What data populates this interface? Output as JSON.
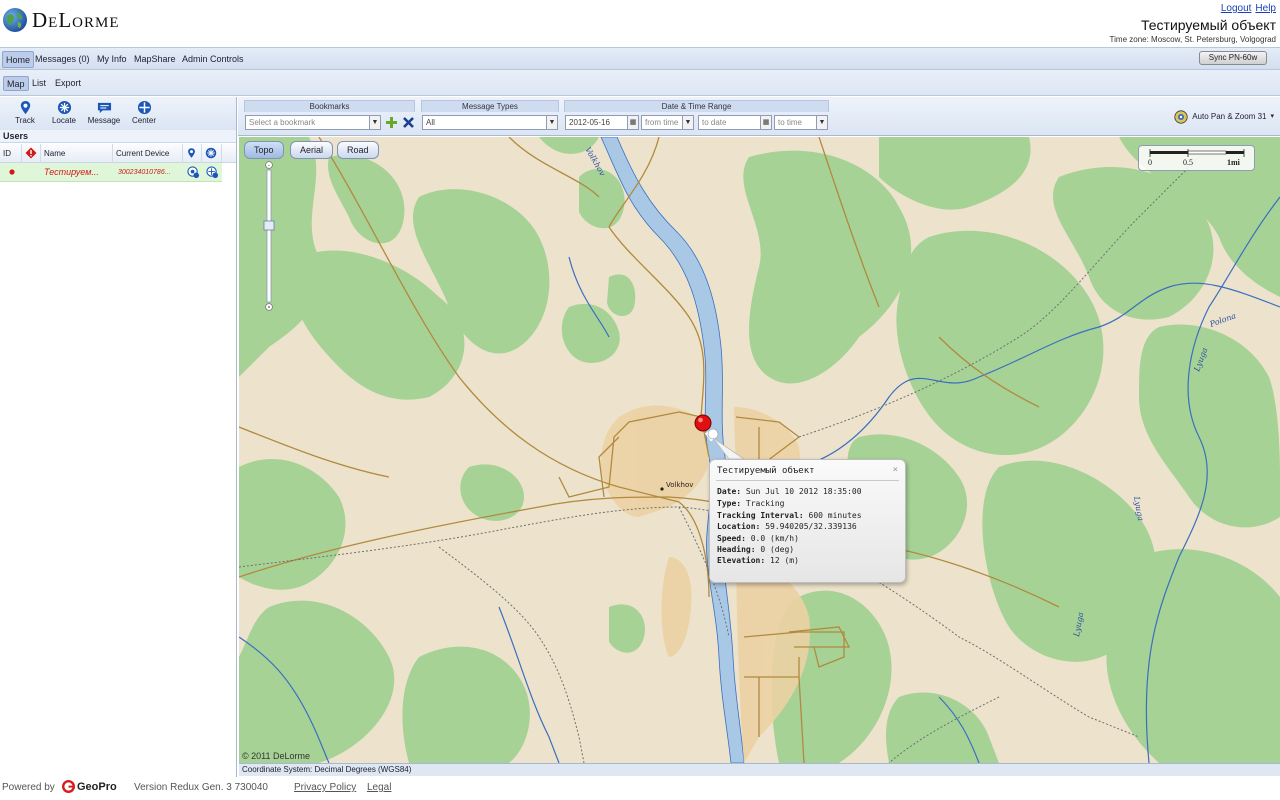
{
  "header": {
    "logo_text": "DeLorme",
    "logout_label": "Logout",
    "help_label": "Help",
    "account_title": "Тестируемый объект",
    "timezone": "Time zone: Moscow, St. Petersburg, Volgograd"
  },
  "nav": {
    "items": [
      "Home",
      "Messages (0)",
      "My Info",
      "MapShare",
      "Admin Controls"
    ],
    "active": "Home",
    "sync_label": "Sync PN-60w"
  },
  "subnav": {
    "items": [
      "Map",
      "List",
      "Export"
    ],
    "active": "Map"
  },
  "tools": {
    "track": "Track",
    "locate": "Locate",
    "message": "Message",
    "center": "Center"
  },
  "users": {
    "title": "Users",
    "columns": [
      "ID",
      "Name",
      "Current Device"
    ],
    "rows": [
      {
        "name": "Тестируем...",
        "device": "300234010786..."
      }
    ]
  },
  "filters": {
    "bookmarks_title": "Bookmarks",
    "bookmark_placeholder": "Select a bookmark",
    "message_types_title": "Message Types",
    "message_types_value": "All",
    "date_range_title": "Date & Time Range",
    "from_date": "2012-05-16",
    "from_time": "from time",
    "to_date": "to date",
    "to_time": "to time",
    "autopan": "Auto Pan & Zoom 31"
  },
  "map": {
    "types": [
      "Topo",
      "Aerial",
      "Road"
    ],
    "active_type": "Topo",
    "scale_labels": [
      "0",
      "0.5",
      "1mi"
    ],
    "copyright": "© 2011 DeLorme",
    "place_label": "Volkhov",
    "river_labels": [
      "Volkhov",
      "Polona",
      "Lyuga",
      "Lyuga",
      "Lyuga"
    ],
    "colors": {
      "land": "#ede3cc",
      "forest": "#a7d296",
      "water": "#a8c8e6",
      "road": "#b08a3e",
      "marker": "#e01010"
    }
  },
  "popup": {
    "title": "Тестируемый объект",
    "close": "×",
    "date_label": "Date:",
    "date_value": "Sun Jul  10 2012 18:35:00",
    "type_label": "Type:",
    "type_value": "Tracking",
    "interval_label": "Tracking Interval:",
    "interval_value": "600 minutes",
    "location_label": "Location:",
    "location_value": "59.940205/32.339136",
    "speed_label": "Speed:",
    "speed_value": "0.0 (km/h)",
    "heading_label": "Heading:",
    "heading_value": "0 (deg)",
    "elevation_label": "Elevation:",
    "elevation_value": "12 (m)"
  },
  "coord_system": "Coordinate System: Decimal Degrees (WGS84)",
  "footer": {
    "powered_by": "Powered by",
    "brand": "GeoPro",
    "version": "Version Redux Gen. 3 730040",
    "privacy": "Privacy Policy",
    "legal": "Legal"
  }
}
